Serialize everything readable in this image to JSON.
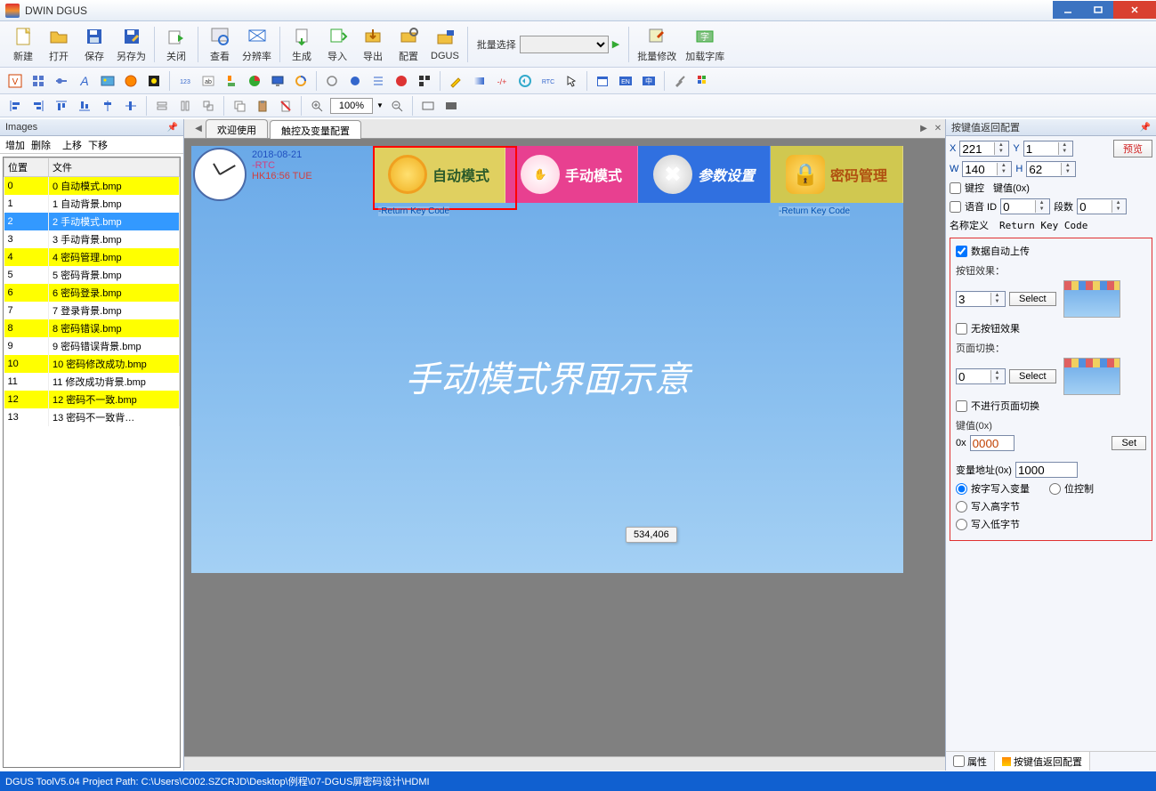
{
  "window": {
    "title": "DWIN DGUS"
  },
  "toolbar_main": {
    "new": "新建",
    "open": "打开",
    "save": "保存",
    "save_as": "另存为",
    "close": "关闭",
    "view": "查看",
    "resolution": "分辨率",
    "generate": "生成",
    "import": "导入",
    "export": "导出",
    "config": "配置",
    "dgus": "DGUS",
    "batch_label": "批量选择",
    "batch_edit": "批量修改",
    "load_font": "加载字库"
  },
  "toolbar3": {
    "zoom": "100%"
  },
  "left": {
    "title": "Images",
    "actions": {
      "add": "增加",
      "del": "删除",
      "up": "上移",
      "down": "下移"
    },
    "cols": {
      "pos": "位置",
      "file": "文件"
    },
    "rows": [
      {
        "i": "0",
        "f": "0 自动模式.bmp",
        "y": true
      },
      {
        "i": "1",
        "f": "1 自动背景.bmp"
      },
      {
        "i": "2",
        "f": "2 手动模式.bmp",
        "sel": true
      },
      {
        "i": "3",
        "f": "3 手动背景.bmp"
      },
      {
        "i": "4",
        "f": "4 密码管理.bmp",
        "y": true
      },
      {
        "i": "5",
        "f": "5 密码背景.bmp"
      },
      {
        "i": "6",
        "f": "6 密码登录.bmp",
        "y": true
      },
      {
        "i": "7",
        "f": "7 登录背景.bmp"
      },
      {
        "i": "8",
        "f": "8 密码错误.bmp",
        "y": true
      },
      {
        "i": "9",
        "f": "9 密码错误背景.bmp"
      },
      {
        "i": "10",
        "f": "10 密码修改成功.bmp",
        "y": true
      },
      {
        "i": "11",
        "f": "11 修改成功背景.bmp"
      },
      {
        "i": "12",
        "f": "12 密码不一致.bmp",
        "y": true
      },
      {
        "i": "13",
        "f": "13 密码不一致背…"
      }
    ]
  },
  "tabs": {
    "welcome": "欢迎使用",
    "touch": "触控及变量配置"
  },
  "canvas": {
    "rtc_date": "2018-08-21",
    "rtc_sub": "-RTC",
    "rtc_time": "HK16:56 TUE",
    "btn_auto": "自动模式",
    "btn_manual": "手动模式",
    "btn_param": "参数设置",
    "btn_pwd": "密码管理",
    "headline": "手动模式界面示意",
    "ret1": "-Return Key Code",
    "ret2": "-Return Key Code",
    "coord": "534,406"
  },
  "right": {
    "title": "按键值返回配置",
    "x_lbl": "X",
    "x": "221",
    "y_lbl": "Y",
    "y": "1",
    "w_lbl": "W",
    "w": "140",
    "h_lbl": "H",
    "h": "62",
    "preview": "预览",
    "keyctl": "键控",
    "keyval_lbl": "键值(0x)",
    "voice": "语音 ID",
    "voice_val": "0",
    "segs_lbl": "段数",
    "segs": "0",
    "name_def": "名称定义",
    "name_val": "Return Key Code",
    "auto_upload": "数据自动上传",
    "btn_effect_lbl": "按钮效果：",
    "btn_effect_val": "3",
    "select": "Select",
    "no_btn_effect": "无按钮效果",
    "page_switch_lbl": "页面切换：",
    "page_switch_val": "0",
    "no_page_switch": "不进行页面切换",
    "keyval_hex_lbl": "键值(0x)",
    "ox": "0x",
    "hex": "0000",
    "set": "Set",
    "var_addr_lbl": "变量地址(0x)",
    "var_addr": "1000",
    "radio_write": "按字写入变量",
    "radio_bit": "位控制",
    "radio_high": "写入高字节",
    "radio_low": "写入低字节",
    "tab_attr": "属性",
    "tab_prop": "按键值返回配置"
  },
  "status": "DGUS ToolV5.04  Project Path: C:\\Users\\C002.SZCRJD\\Desktop\\例程\\07-DGUS屏密码设计\\HDMI"
}
